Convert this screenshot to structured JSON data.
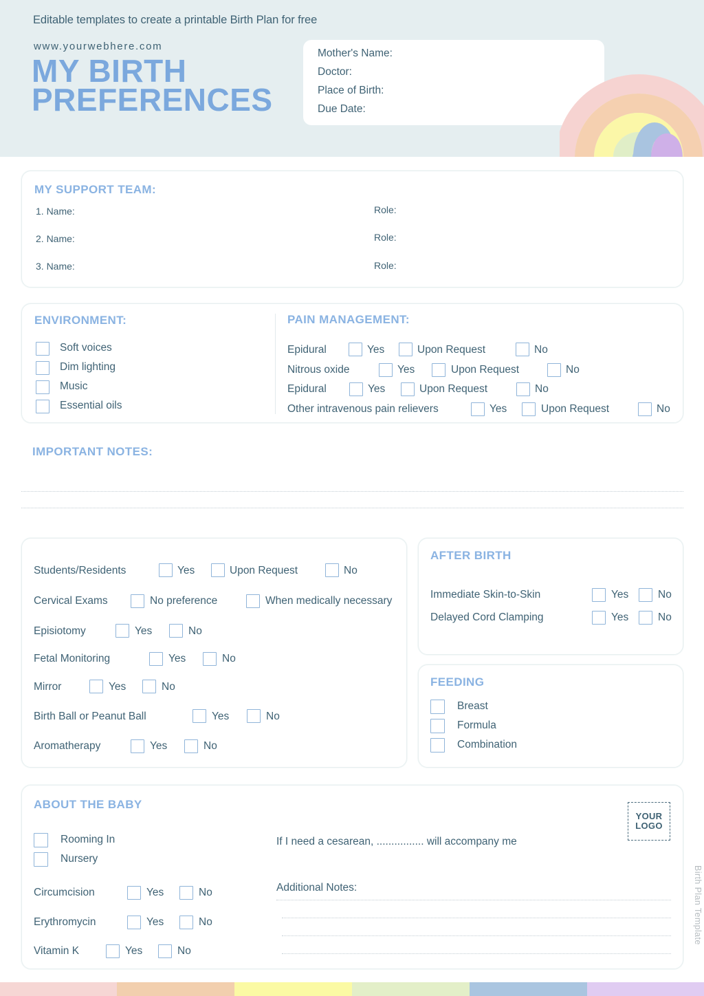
{
  "header": {
    "tagline": "Editable templates to create a printable Birth Plan for free",
    "website": "www.yourwebhere.com",
    "title_line1": "MY BIRTH",
    "title_line2": "PREFERENCES",
    "info_fields": [
      "Mother's Name:",
      "Doctor:",
      "Place of Birth:",
      "Due Date:"
    ],
    "background_color": "#e5eef0",
    "title_color": "#7ba8dd",
    "rainbow_colors": [
      "#f6d3d1",
      "#f5d0b0",
      "#fbf7a8",
      "#e0eec7",
      "#a9c4e0",
      "#cfb0e8"
    ]
  },
  "support_team": {
    "heading": "MY SUPPORT TEAM:",
    "rows": [
      {
        "name": "1. Name:",
        "role": "Role:"
      },
      {
        "name": "2. Name:",
        "role": "Role:"
      },
      {
        "name": "3. Name:",
        "role": "Role:"
      }
    ]
  },
  "environment": {
    "heading": "ENVIRONMENT:",
    "options": [
      "Soft voices",
      "Dim lighting",
      "Music",
      "Essential oils"
    ]
  },
  "pain_management": {
    "heading": "PAIN MANAGEMENT:",
    "rows": [
      {
        "label": "Epidural",
        "choices": [
          "Yes",
          "Upon Request",
          "No"
        ]
      },
      {
        "label": "Nitrous oxide",
        "choices": [
          "Yes",
          "Upon Request",
          "No"
        ]
      },
      {
        "label": "Epidural",
        "choices": [
          "Yes",
          "Upon Request",
          "No"
        ]
      },
      {
        "label": "Other intravenous pain relievers",
        "choices": [
          "Yes",
          "Upon Request",
          "No"
        ]
      }
    ]
  },
  "important_notes": {
    "heading": "IMPORTANT NOTES:",
    "line_count": 2
  },
  "procedures": {
    "rows": [
      {
        "label": "Students/Residents",
        "choices": [
          "Yes",
          "Upon Request",
          "No"
        ]
      },
      {
        "label": "Cervical Exams",
        "choices": [
          "No preference",
          "When medically necessary"
        ]
      },
      {
        "label": "Episiotomy",
        "choices": [
          "Yes",
          "No"
        ]
      },
      {
        "label": "Fetal Monitoring",
        "choices": [
          "Yes",
          "No"
        ]
      },
      {
        "label": "Mirror",
        "choices": [
          "Yes",
          "No"
        ]
      },
      {
        "label": "Birth Ball or Peanut Ball",
        "choices": [
          "Yes",
          "No"
        ]
      },
      {
        "label": "Aromatherapy",
        "choices": [
          "Yes",
          "No"
        ]
      }
    ]
  },
  "after_birth": {
    "heading": "AFTER BIRTH",
    "rows": [
      {
        "label": "Immediate Skin-to-Skin",
        "choices": [
          "Yes",
          "No"
        ]
      },
      {
        "label": "Delayed Cord Clamping",
        "choices": [
          "Yes",
          "No"
        ]
      }
    ]
  },
  "feeding": {
    "heading": "FEEDING",
    "options": [
      "Breast",
      "Formula",
      "Combination"
    ]
  },
  "about_baby": {
    "heading": "ABOUT THE BABY",
    "checkbox_options": [
      "Rooming In",
      "Nursery"
    ],
    "rows": [
      {
        "label": "Circumcision",
        "choices": [
          "Yes",
          "No"
        ]
      },
      {
        "label": "Erythromycin",
        "choices": [
          "Yes",
          "No"
        ]
      },
      {
        "label": "Vitamin K",
        "choices": [
          "Yes",
          "No"
        ]
      }
    ],
    "cesarean_text": "If I need a cesarean, ................ will accompany me",
    "additional_notes_label": "Additional Notes:",
    "additional_notes_line_count": 4,
    "logo_line1": "YOUR",
    "logo_line2": "LOGO"
  },
  "side_text": "Birth Plan Template",
  "footer": {
    "colors": [
      "#f6d6d4",
      "#f2cfae",
      "#fbfaa4",
      "#e3efc8",
      "#aac5e0",
      "#e0ccf2"
    ]
  }
}
